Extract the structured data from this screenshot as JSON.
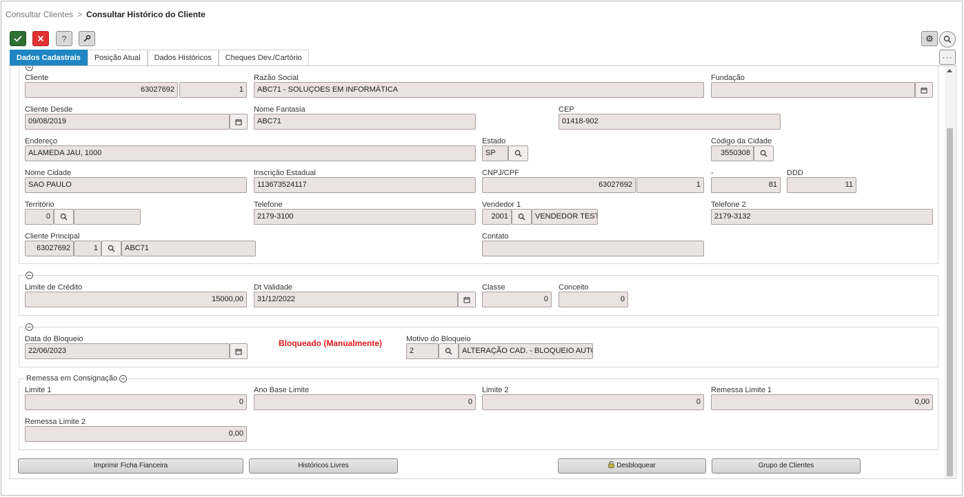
{
  "breadcrumb": {
    "parent": "Consultar Clientes",
    "separator": ">",
    "current": "Consultar Histórico do Cliente"
  },
  "toolbar": {
    "help_label": "?",
    "more_label": "···"
  },
  "tabs": [
    {
      "label": "Dados Cadastrais",
      "active": true
    },
    {
      "label": "Posição Atual",
      "active": false
    },
    {
      "label": "Dados Históricos",
      "active": false
    },
    {
      "label": "Cheques Dev./Cartório",
      "active": false
    }
  ],
  "cadastro": {
    "cliente": {
      "label": "Cliente",
      "codigo": "63027692",
      "loja": "1"
    },
    "razao_social": {
      "label": "Razão Social",
      "value": "ABC71 - SOLUÇOES EM INFORMÁTICA"
    },
    "fundacao": {
      "label": "Fundação",
      "value": ""
    },
    "cliente_desde": {
      "label": "Cliente Desde",
      "value": "09/08/2019"
    },
    "nome_fantasia": {
      "label": "Nome Fantasia",
      "value": "ABC71"
    },
    "cep": {
      "label": "CEP",
      "value": "01418-902"
    },
    "endereco": {
      "label": "Endereço",
      "value": "ALAMEDA JAU, 1000"
    },
    "estado": {
      "label": "Estado",
      "value": "SP"
    },
    "codigo_cidade": {
      "label": "Código da Cidade",
      "value": "3550308"
    },
    "nome_cidade": {
      "label": "Nome Cidade",
      "value": "SAO PAULO"
    },
    "inscricao_estadual": {
      "label": "Inscrição Estadual",
      "value": "113673524117"
    },
    "cnpj_cpf": {
      "label": "CNPJ/CPF",
      "value": "63027692",
      "filial": "1"
    },
    "ddd_prefix": {
      "label": "-",
      "value": "81"
    },
    "ddd": {
      "label": "DDD",
      "value": "11"
    },
    "territorio": {
      "label": "Território",
      "value": "0",
      "desc": ""
    },
    "telefone": {
      "label": "Telefone",
      "value": "2179-3100"
    },
    "vendedor": {
      "label": "Vendedor 1",
      "codigo": "2001",
      "nome": "VENDEDOR TESTE"
    },
    "telefone2": {
      "label": "Telefone 2",
      "value": "2179-3132"
    },
    "cliente_principal": {
      "label": "Cliente Principal",
      "codigo": "63027692",
      "loja": "1",
      "nome": "ABC71"
    },
    "contato": {
      "label": "Contato",
      "value": ""
    }
  },
  "credito": {
    "limite": {
      "label": "Limite de Crédito",
      "value": "15000,00"
    },
    "dt_validade": {
      "label": "Dt Validade",
      "value": "31/12/2022"
    },
    "classe": {
      "label": "Classe",
      "value": "0"
    },
    "conceito": {
      "label": "Conceito",
      "value": "0"
    }
  },
  "bloqueio": {
    "data": {
      "label": "Data do Bloqueio",
      "value": "22/06/2023"
    },
    "status": "Bloqueado (Manualmente)",
    "status_color": "#e11a1a",
    "motivo": {
      "label": "Motivo do Bloqueio",
      "codigo": "2",
      "desc": "ALTERAÇÃO CAD. - BLOQUEIO AUTOÁTICC"
    }
  },
  "consignacao": {
    "title": "Remessa em Consignação",
    "limite1": {
      "label": "Limite 1",
      "value": "0"
    },
    "ano_base": {
      "label": "Ano Base Limite",
      "value": "0"
    },
    "limite2": {
      "label": "Limite 2",
      "value": "0"
    },
    "remessa_limite1": {
      "label": "Remessa Limite 1",
      "value": "0,00"
    },
    "remessa_limite2": {
      "label": "Remessa Limite 2",
      "value": "0,00"
    }
  },
  "actions": {
    "imprimir": "Imprimir Ficha Fianceira",
    "historicos": "Históricos Livres",
    "desbloquear": "Desbloquear",
    "grupo": "Grupo de Clientes"
  },
  "colors": {
    "accent": "#1f86c3",
    "ok": "#2e6f32",
    "cancel": "#e03131",
    "field_bg": "#ebe2e2"
  }
}
